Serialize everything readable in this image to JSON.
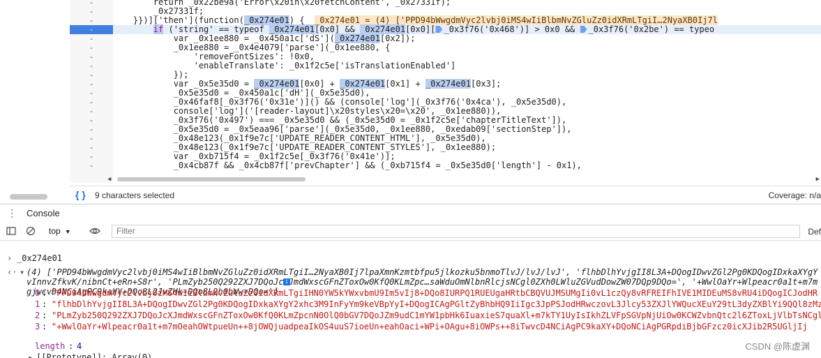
{
  "gutter": [
    "-",
    "-",
    "-",
    "-",
    "-",
    "-",
    "-",
    "-",
    "-",
    "-",
    "-",
    "-",
    "-",
    "-",
    "-",
    "-",
    "-",
    "-",
    "-",
    "-"
  ],
  "code_lines": [
    {
      "segments": [
        {
          "t": "        return _0x22be9a('Error\\x20in\\x20fetchContent', _0x27331f);",
          "c": ""
        }
      ]
    },
    {
      "segments": [
        {
          "t": "        _0x27331f;",
          "c": ""
        }
      ]
    },
    {
      "segments": [
        {
          "t": "    }})]['then'](function(",
          "c": ""
        },
        {
          "t": "_0x274e01",
          "c": "hl"
        },
        {
          "t": ") {  ",
          "c": ""
        },
        {
          "t": "_0x274e01 = (4) ['PPD94bWwgdmVyc2lvbj0iMS4wIiBlbmNvZGluZz0idXRmLTgiI…2NyaXB0Ij7l",
          "c": "ann"
        }
      ]
    },
    {
      "segments": [
        {
          "t": "        ",
          "c": ""
        },
        {
          "t": "if",
          "c": "kw hl"
        },
        {
          "t": " ('string' == typeof ",
          "c": ""
        },
        {
          "t": "_0x274e01",
          "c": "hl"
        },
        {
          "t": "[0x0] && ",
          "c": ""
        },
        {
          "t": "_0x274e01",
          "c": "hl"
        },
        {
          "t": "[0x0][",
          "c": ""
        },
        {
          "t": "BP",
          "c": "bp"
        },
        {
          "t": "_0x3f76('0x468')] > 0x0 && ",
          "c": ""
        },
        {
          "t": "BP",
          "c": "bp"
        },
        {
          "t": "_0x3f76('0x2be') == typeo",
          "c": ""
        }
      ],
      "active": true
    },
    {
      "segments": [
        {
          "t": "            var _0x1ee880 = _0x450a1c['dS'](",
          "c": ""
        },
        {
          "t": "_0x274e01",
          "c": "hl"
        },
        {
          "t": "[0x2]);",
          "c": ""
        }
      ]
    },
    {
      "segments": [
        {
          "t": "            _0x1ee880 = _0x4e4079['parse'](_0x1ee880, {",
          "c": ""
        }
      ]
    },
    {
      "segments": [
        {
          "t": "                'removeFontSizes': !0x0,",
          "c": ""
        }
      ]
    },
    {
      "segments": [
        {
          "t": "                'enableTranslate': _0x1f2c5e['isTranslationEnabled']",
          "c": ""
        }
      ]
    },
    {
      "segments": [
        {
          "t": "            });",
          "c": ""
        }
      ]
    },
    {
      "segments": [
        {
          "t": "            var _0x5e35d0 = ",
          "c": ""
        },
        {
          "t": "_0x274e01",
          "c": "hl"
        },
        {
          "t": "[0x0] + ",
          "c": ""
        },
        {
          "t": "_0x274e01",
          "c": "hl"
        },
        {
          "t": "[0x1] + ",
          "c": ""
        },
        {
          "t": "_0x274e01",
          "c": "hl"
        },
        {
          "t": "[0x3];",
          "c": ""
        }
      ]
    },
    {
      "segments": [
        {
          "t": "            _0x5e35d0 = _0x450a1c['dH'](_0x5e35d0),",
          "c": ""
        }
      ]
    },
    {
      "segments": [
        {
          "t": "            _0x46faf8[_0x3f76('0x31e')]() && (console['log'](_0x3f76('0x4ca'), _0x5e35d0),",
          "c": ""
        }
      ]
    },
    {
      "segments": [
        {
          "t": "            console['log']('[reader-layout]\\x20styles\\x20=\\x20', _0x1ee880)),",
          "c": ""
        }
      ]
    },
    {
      "segments": [
        {
          "t": "            _0x3f76('0x497') === _0x5e35d0 && (_0x5e35d0 = _0x1f2c5e['chapterTitleText']),",
          "c": ""
        }
      ]
    },
    {
      "segments": [
        {
          "t": "            _0x5e35d0 = _0x5eaa96['parse'](_0x5e35d0, _0x1ee880, _0xedab09['sectionStep']),",
          "c": ""
        }
      ]
    },
    {
      "segments": [
        {
          "t": "            _0x48e123(_0x1f9e7c['UPDATE_READER_CONTENT_HTML'], _0x5e35d0),",
          "c": ""
        }
      ]
    },
    {
      "segments": [
        {
          "t": "            _0x48e123(_0x1f9e7c['UPDATE_READER_CONTENT_STYLES'], _0x1ee880);",
          "c": ""
        }
      ]
    },
    {
      "segments": [
        {
          "t": "            var _0xb715f4 = _0x1f2c5e[_0x3f76('0x41e')];",
          "c": ""
        }
      ]
    },
    {
      "segments": [
        {
          "t": "            _0x4cb87f && _0x4cb87f['prevChapter'] && (_0xb715f4 = _0x5e35d0['length'] - 0x1),",
          "c": ""
        }
      ]
    }
  ],
  "status": {
    "braces": "{ }",
    "selected": "9 characters selected",
    "coverage": "Coverage: n/a"
  },
  "tabs": {
    "console": "Console"
  },
  "toolbar": {
    "context": "top",
    "filter_placeholder": "Filter",
    "levels": "Def"
  },
  "console": {
    "input": "_0x274e01",
    "preview_1": "(4) ['PPD94bWwgdmVyc2lvbj0iMS4wIiBlbmNvZGluZz0idXRmLTgiI…2NyaXB0Ij7lpaXmnKzmtbfpu5jlkozku5bnmoTlvJ/lvJ/lvJ', 'flhbDlhYvjgII8L3A+DQogIDwvZGl2Pg0KDQogIDxkaXYgY",
    "preview_2": "vInnvZfkvK/nibnCt+eRn+S8r', 'PLmZyb250Q292ZXJ7DQoJcXJmdWxscGFnZToxOw0KfQ0KLmZpc…saWduOmNlbnRlcjsNCgl0ZXh0LWluZGVudDowZW07DQp9DQo=', '+WwlOaYr+Wlpeacr0a1t+m7m",
    "preview_3": "gjwcvD4NCiAgPC9kaXY+DQo8L2JvZHk+DQo8L2h0bWw+DQo=']",
    "items": [
      {
        "idx": "0",
        "val": "\"PPD94bWwgdmVyc2lvbj0iMS4wIiBlbmNvZGluZz0idXRmLTgiIHN0YW5kYWxvbmU9Im5vIj8+DQo8IURPQ1RUEUgaHRtbCBQVUJMSUMgIi0vL1czQy8vRFREIFhIVE1MIDEuMS8vRU4iDQogICJodHR"
      },
      {
        "idx": "1",
        "val": "\"flhbDlhYvjgII8L3A+DQogIDwvZGl2Pg0KDQogIDxkaXYgY2xhc3M9InFyYm9keVBpYyI+DQogICAgPGltZyBhbHQ9IiIgc3JpPSJodHRwczovL3Jlcy53ZXJlYWQucXEuY29tL3dyZXBlYi9QQl8zMz"
      },
      {
        "idx": "2",
        "val": "\"PLmZyb250Q292ZXJ7DQoJcXJmdWxscGFnZToxOw0KfQ0KLmZpcnN0OlQ0bGV7DQoJZm9udC1mYW1pbHk6IuaxieS7quaXl+m7kTY1UyIsIkhZLVFpSGVpNjUiOw0KCWZvbnQtc2l6ZToxLjVlbTsNCgl"
      },
      {
        "idx": "3",
        "val": "\"+WwlOaYr+Wlpeacr0a1t+m7mOeahOWtpueUn++8jOWQjuadpeaIkOS4uuS7ioeUn+eahOaci+WPi+OAgu+8iOWPs++8iTwvcD4NCiAgPC9kaXY+DQoNCiAgPGRpdiBjbGFzcz0icXJib2R5UGljIj"
      }
    ],
    "length_label": "length",
    "length_value": "4",
    "prototype": "[[Prototype]]: Array(0)"
  },
  "watermark": "CSDN @陈虚渊",
  "icon_names": [
    "braces-icon",
    "menu-dots-icon",
    "sidebar-toggle-icon",
    "clear-console-icon",
    "eye-icon",
    "info-icon"
  ]
}
